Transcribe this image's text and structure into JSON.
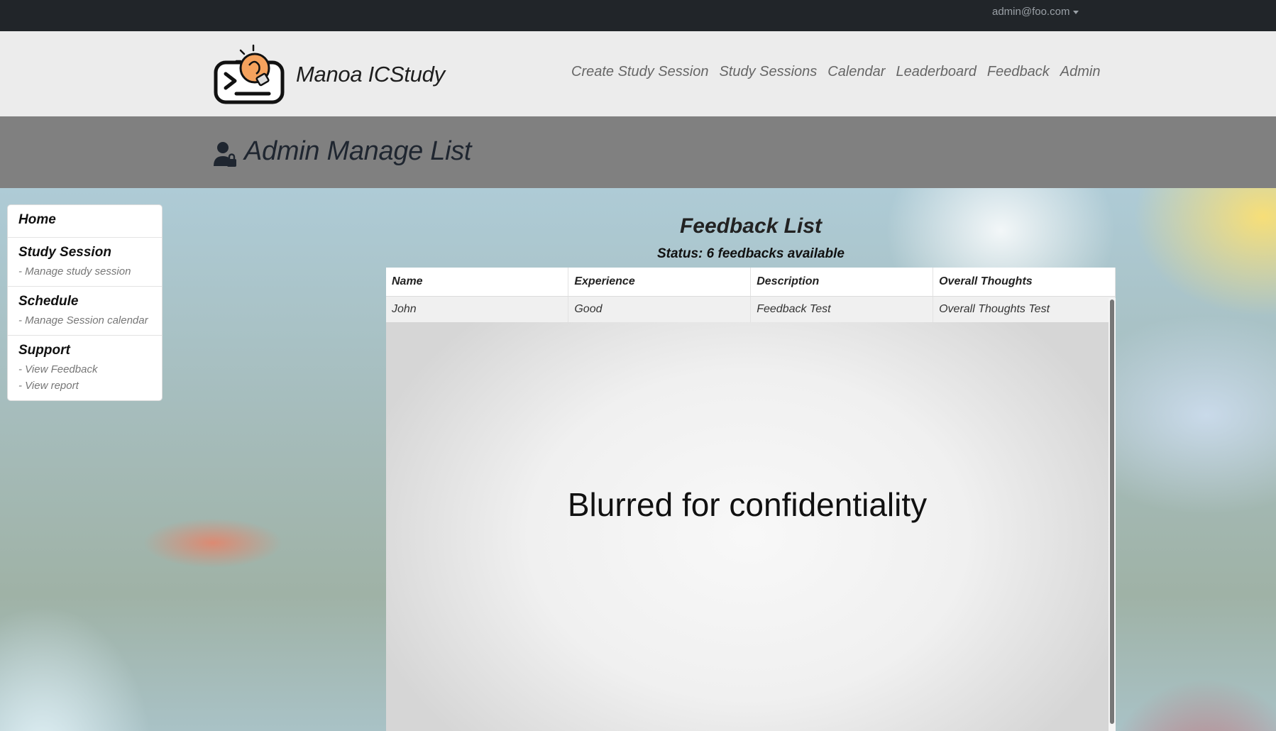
{
  "user": {
    "email": "admin@foo.com"
  },
  "brand": {
    "name": "Manoa ICStudy"
  },
  "nav": {
    "links": [
      "Create Study Session",
      "Study Sessions",
      "Calendar",
      "Leaderboard",
      "Feedback",
      "Admin"
    ]
  },
  "page": {
    "title": "Admin Manage List"
  },
  "sidebar": {
    "home": "Home",
    "study_session": {
      "title": "Study Session",
      "sub": "- Manage study session"
    },
    "schedule": {
      "title": "Schedule",
      "sub": "- Manage Session calendar"
    },
    "support": {
      "title": "Support",
      "subs": [
        "- View Feedback",
        "- View report"
      ]
    }
  },
  "feedback": {
    "title": "Feedback List",
    "status": "Status: 6 feedbacks available",
    "columns": [
      "Name",
      "Experience",
      "Description",
      "Overall Thoughts"
    ],
    "rows": [
      [
        "John",
        "Good",
        "Feedback Test",
        "Overall Thoughts Test"
      ]
    ],
    "overlay_text": "Blurred for confidentiality"
  },
  "colors": {
    "topbar": "#212529",
    "navbar": "#ececec",
    "header_band": "#808080",
    "logo_orange": "#f5a25d"
  }
}
